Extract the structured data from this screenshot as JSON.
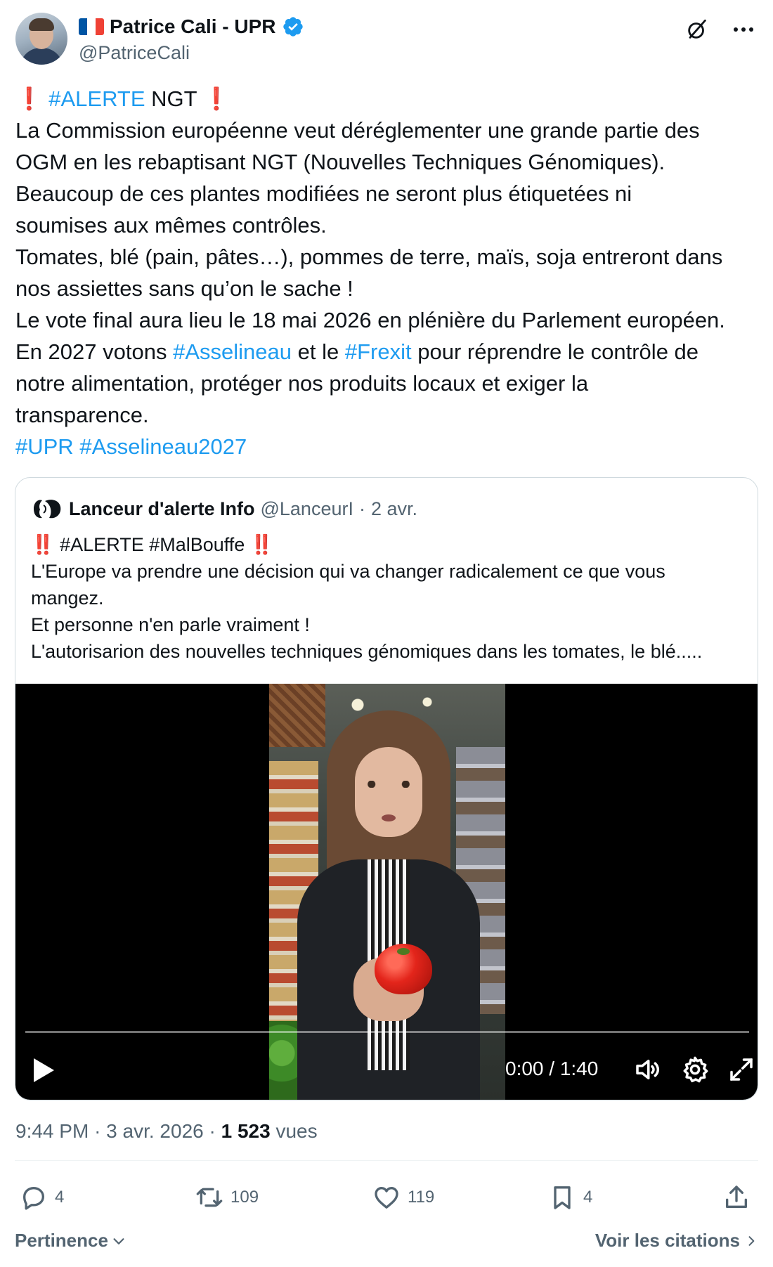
{
  "author": {
    "display_name": "Patrice Cali - UPR",
    "handle": "@PatriceCali",
    "verified": true,
    "flag_colors": [
      "#0055a4",
      "#ffffff",
      "#ef4135"
    ]
  },
  "tweet": {
    "headline": {
      "exclamation": "❗",
      "hashtag": "#ALERTE",
      "word": "NGT"
    },
    "lines": [
      "La Commission européenne veut déréglementer une grande partie des",
      "OGM en les rebaptisant NGT (Nouvelles Techniques Génomiques).",
      "Beaucoup de ces plantes modifiées ne seront plus étiquetées ni",
      "soumises aux mêmes contrôles.",
      "Tomates, blé (pain, pâtes…), pommes de terre, maïs, soja entreront dans",
      "nos assiettes sans qu’on le sache !",
      "Le vote final aura lieu le 18 mai 2026 en plénière du Parlement européen."
    ],
    "line_vote": {
      "pre": "En 2027 votons",
      "tag1": "#Asselineau",
      "mid": "et le",
      "tag2": "#Frexit",
      "post": "pour réprendre le contrôle de"
    },
    "lines_after": [
      "notre alimentation, protéger nos produits locaux et exiger la",
      "transparence."
    ],
    "hashtags": [
      "#UPR",
      "#Asselineau2027"
    ]
  },
  "quoted": {
    "name": "Lanceur d'alerte Info",
    "handle": "@LanceurI",
    "date": "2 avr.",
    "headline": {
      "exclamation": "‼️",
      "tags": "#ALERTE #MalBouffe"
    },
    "lines": [
      "L'Europe va prendre une décision qui va changer radicalement ce que vous",
      "mangez.",
      "Et personne n'en parle vraiment !",
      "L'autorisarion des nouvelles techniques génomiques dans les tomates, le blé....."
    ],
    "video": {
      "time": "0:00 / 1:40",
      "progress": 0
    }
  },
  "meta": {
    "time": "9:44 PM",
    "date": "3 avr. 2026",
    "views": "1 523",
    "views_label": "vues"
  },
  "actions": {
    "replies": "4",
    "reposts": "109",
    "likes": "119",
    "bookmarks": "4"
  },
  "footer": {
    "sort_label": "Pertinence",
    "quotes_label": "Voir les citations"
  },
  "colors": {
    "link": "#1d9bf0",
    "secondary_text": "#536471",
    "primary_text": "#0f1419",
    "verified_badge": "#1d9bf0"
  },
  "icons": [
    "verified-badge-icon",
    "grok-icon",
    "more-icon",
    "play-icon",
    "volume-icon",
    "settings-icon",
    "fullscreen-icon",
    "reply-icon",
    "repost-icon",
    "like-icon",
    "bookmark-icon",
    "share-icon",
    "chevron-down-icon",
    "chevron-right-icon"
  ]
}
